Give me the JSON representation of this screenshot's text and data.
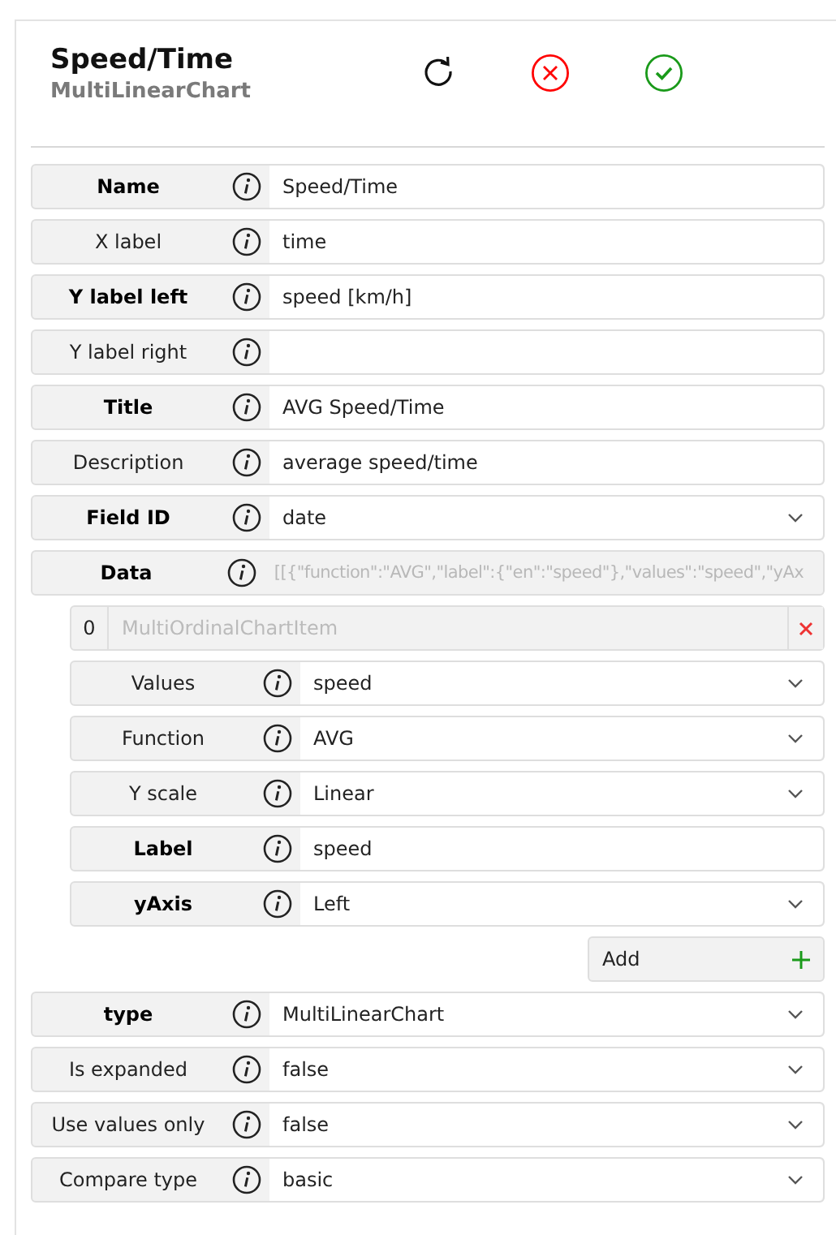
{
  "header": {
    "title": "Speed/Time",
    "subtitle": "MultiLinearChart"
  },
  "fields": [
    {
      "label": "Name",
      "required": true,
      "kind": "text",
      "value": "Speed/Time"
    },
    {
      "label": "X label",
      "required": false,
      "kind": "text",
      "value": "time"
    },
    {
      "label": "Y label left",
      "required": true,
      "kind": "text",
      "value": "speed [km/h]"
    },
    {
      "label": "Y label right",
      "required": false,
      "kind": "text"
    },
    {
      "label": "Title",
      "required": true,
      "kind": "text",
      "value": "AVG Speed/Time"
    },
    {
      "label": "Description",
      "required": false,
      "kind": "text",
      "value": "average speed/time"
    },
    {
      "label": "Field ID",
      "required": true,
      "kind": "select",
      "value": "date"
    },
    {
      "label": "Data",
      "required": true,
      "kind": "list",
      "disabled": true,
      "value": "[[{\"function\":\"AVG\",\"label\":{\"en\":\"speed\"},\"values\":\"speed\",\"yAx",
      "add_label": "Add",
      "items": [
        {
          "index": "0",
          "name": "MultiOrdinalChartItem",
          "fields": [
            {
              "label": "Values",
              "required": false,
              "kind": "select",
              "value": "speed"
            },
            {
              "label": "Function",
              "required": false,
              "kind": "select",
              "value": "AVG"
            },
            {
              "label": "Y scale",
              "required": false,
              "kind": "select",
              "value": "Linear"
            },
            {
              "label": "Label",
              "required": true,
              "kind": "text",
              "value": "speed"
            },
            {
              "label": "yAxis",
              "required": true,
              "kind": "select",
              "value": "Left"
            }
          ]
        }
      ]
    },
    {
      "label": "type",
      "required": true,
      "kind": "select",
      "value": "MultiLinearChart"
    },
    {
      "label": "Is expanded",
      "required": false,
      "kind": "select",
      "value": "false"
    },
    {
      "label": "Use values only",
      "required": false,
      "kind": "select",
      "value": "false"
    },
    {
      "label": "Compare type",
      "required": false,
      "kind": "select",
      "value": "basic"
    }
  ]
}
